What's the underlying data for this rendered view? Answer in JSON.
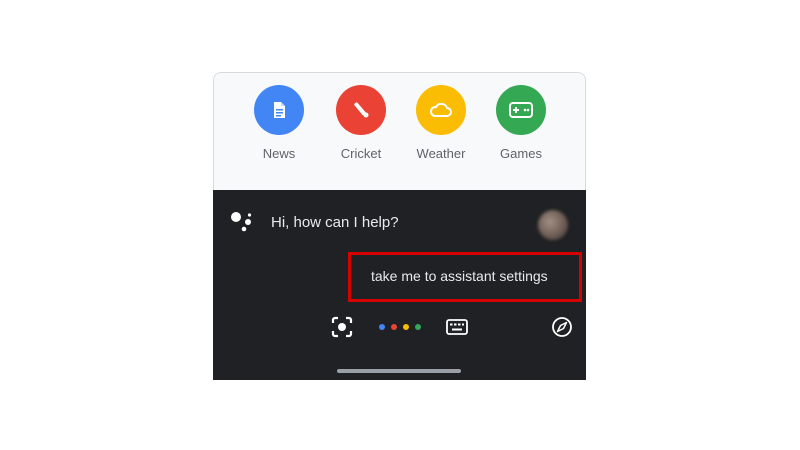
{
  "shortcuts": [
    {
      "label": "News",
      "icon": "news-document-icon",
      "color": "#4285f4"
    },
    {
      "label": "Cricket",
      "icon": "cricket-bat-icon",
      "color": "#ea4335"
    },
    {
      "label": "Weather",
      "icon": "cloud-icon",
      "color": "#fbbc04"
    },
    {
      "label": "Games",
      "icon": "gamepad-icon",
      "color": "#34a853"
    }
  ],
  "assistant": {
    "greeting": "Hi, how can I help?",
    "query": "take me to assistant settings",
    "panel_color": "#202124",
    "highlight_color": "#d50000",
    "logo_icon": "google-assistant-logo-icon",
    "avatar_icon": "user-avatar-icon"
  },
  "toolbar": {
    "left_icon": "lens-icon",
    "center_icon": "mic-dots-icon",
    "right_icon": "keyboard-icon",
    "far_right_icon": "compass-icon"
  },
  "brand_colors": [
    "#4285f4",
    "#ea4335",
    "#fbbc04",
    "#34a853"
  ]
}
